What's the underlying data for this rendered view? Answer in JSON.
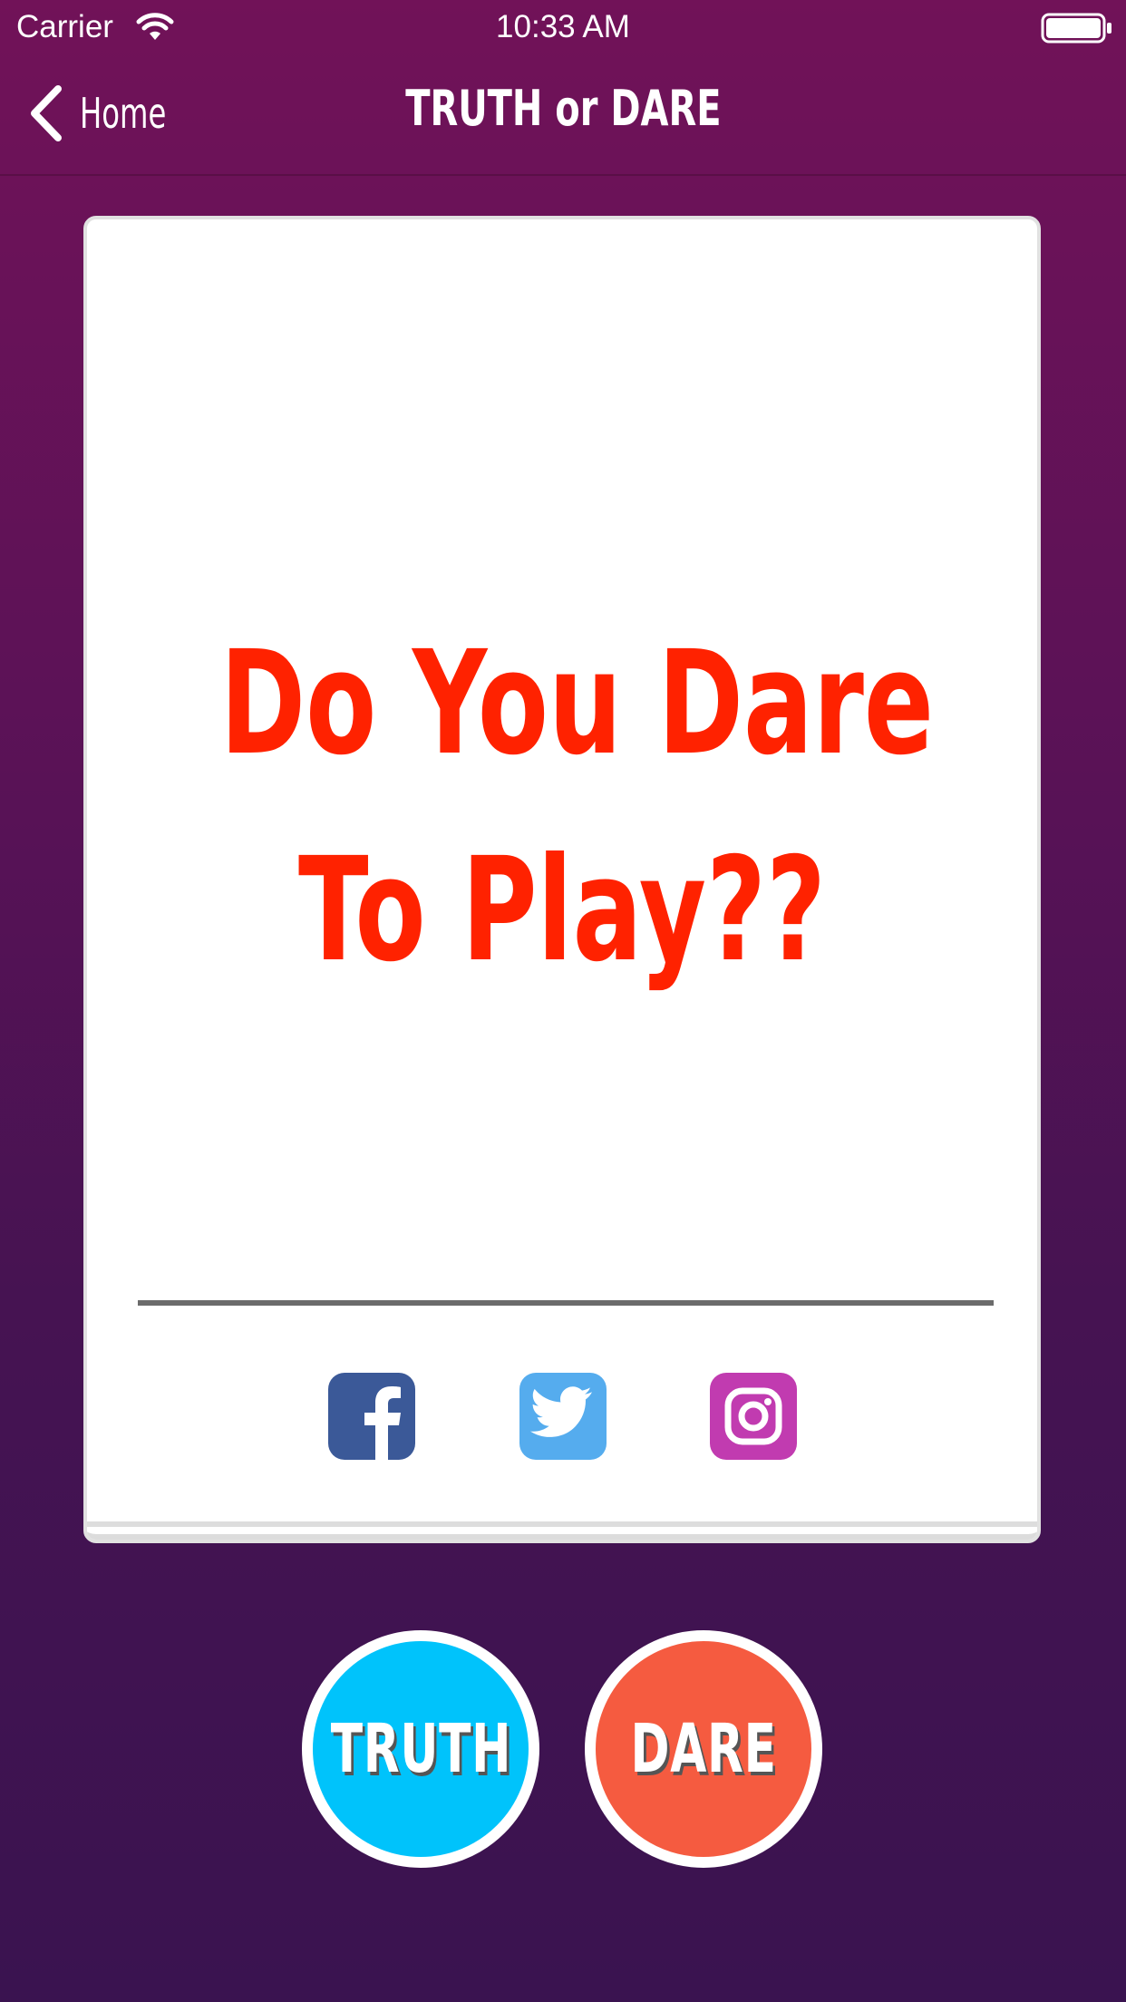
{
  "status_bar": {
    "carrier": "Carrier",
    "time": "10:33 AM",
    "wifi_icon": "wifi-icon",
    "battery_icon": "battery-icon"
  },
  "nav": {
    "back_label": "Home",
    "back_icon": "chevron-left-icon",
    "title": "TRUTH or DARE"
  },
  "card": {
    "message_line1": "Do You Dare",
    "message_line2": "To Play??",
    "message_color": "#ff2200",
    "social": [
      {
        "name": "facebook",
        "icon": "facebook-icon",
        "color": "#3b5998"
      },
      {
        "name": "twitter",
        "icon": "twitter-icon",
        "color": "#55acee"
      },
      {
        "name": "instagram",
        "icon": "instagram-icon",
        "color": "#c13bb0"
      }
    ]
  },
  "actions": {
    "truth_label": "TRUTH",
    "truth_color": "#00c3fb",
    "dare_label": "DARE",
    "dare_color": "#f55b40"
  },
  "theme": {
    "background_top": "#711258",
    "background_bottom": "#3a1350"
  }
}
